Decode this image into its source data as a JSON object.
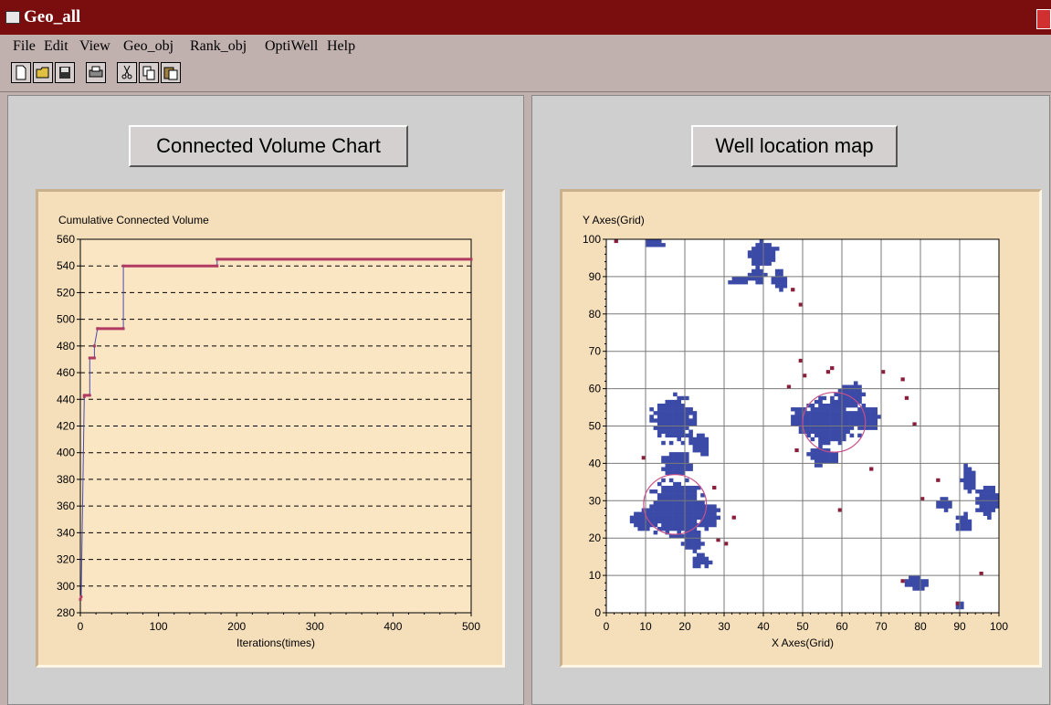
{
  "window": {
    "title": "Geo_all"
  },
  "menu": [
    "File",
    "Edit",
    "View",
    "Geo_obj",
    "Rank_obj",
    "OptiWell",
    "Help"
  ],
  "toolbar": [
    "new-icon",
    "open-icon",
    "save-icon",
    "print-icon",
    "cut-icon",
    "copy-icon",
    "paste-icon"
  ],
  "left_panel": {
    "button_label": "Connected Volume Chart"
  },
  "right_panel": {
    "button_label": "Well location map"
  },
  "chart_data": [
    {
      "type": "line",
      "title": "",
      "ylabel": "Cumulative Connected Volume",
      "xlabel": "Iterations(times)",
      "xlim": [
        0,
        500
      ],
      "ylim": [
        280,
        560
      ],
      "xticks": [
        0,
        100,
        200,
        300,
        400,
        500
      ],
      "yticks": [
        280,
        300,
        320,
        340,
        360,
        380,
        400,
        420,
        440,
        460,
        480,
        500,
        520,
        540,
        560
      ],
      "grid": "horizontal dashed",
      "series": [
        {
          "color": "#b03a62",
          "x": [
            0,
            1,
            5,
            5,
            12,
            12,
            18,
            18,
            22,
            22,
            55,
            55,
            175,
            175,
            500
          ],
          "y": [
            290,
            292,
            442,
            443,
            443,
            471,
            471,
            480,
            493,
            493,
            493,
            540,
            540,
            545,
            545
          ]
        }
      ]
    },
    {
      "type": "scatter",
      "title": "",
      "ylabel": "Y Axes(Grid)",
      "xlabel": "X Axes(Grid)",
      "xlim": [
        0,
        100
      ],
      "ylim": [
        0,
        100
      ],
      "xticks": [
        0,
        10,
        20,
        30,
        40,
        50,
        60,
        70,
        80,
        90,
        100
      ],
      "yticks": [
        0,
        10,
        20,
        30,
        40,
        50,
        60,
        70,
        80,
        90,
        100
      ],
      "grid": true,
      "colors": {
        "connected": "#3a4aa6",
        "isolated": "#8a1f3c",
        "well_circle": "#c8508c"
      },
      "connected_blobs": [
        {
          "cx": 18,
          "cy": 28,
          "rx": 8,
          "ry": 8
        },
        {
          "cx": 10,
          "cy": 25,
          "rx": 4,
          "ry": 3
        },
        {
          "cx": 22,
          "cy": 20,
          "rx": 3,
          "ry": 4
        },
        {
          "cx": 17,
          "cy": 52,
          "rx": 6,
          "ry": 7
        },
        {
          "cx": 18,
          "cy": 40,
          "rx": 4,
          "ry": 4
        },
        {
          "cx": 24,
          "cy": 45,
          "rx": 3,
          "ry": 3
        },
        {
          "cx": 26,
          "cy": 26,
          "rx": 3,
          "ry": 4
        },
        {
          "cx": 24,
          "cy": 14,
          "rx": 3,
          "ry": 2
        },
        {
          "cx": 57,
          "cy": 51,
          "rx": 8,
          "ry": 7
        },
        {
          "cx": 50,
          "cy": 52,
          "rx": 3,
          "ry": 4
        },
        {
          "cx": 62,
          "cy": 58,
          "rx": 4,
          "ry": 4
        },
        {
          "cx": 66,
          "cy": 52,
          "rx": 4,
          "ry": 4
        },
        {
          "cx": 55,
          "cy": 42,
          "rx": 4,
          "ry": 3
        },
        {
          "cx": 40,
          "cy": 96,
          "rx": 4,
          "ry": 4
        },
        {
          "cx": 38,
          "cy": 90,
          "rx": 3,
          "ry": 2
        },
        {
          "cx": 34,
          "cy": 89,
          "rx": 3,
          "ry": 1.5
        },
        {
          "cx": 44,
          "cy": 89,
          "rx": 2,
          "ry": 3
        },
        {
          "cx": 12,
          "cy": 99,
          "rx": 3,
          "ry": 1
        },
        {
          "cx": 97,
          "cy": 30,
          "rx": 3,
          "ry": 5
        },
        {
          "cx": 92,
          "cy": 36,
          "rx": 2,
          "ry": 4
        },
        {
          "cx": 91,
          "cy": 24,
          "rx": 2,
          "ry": 3
        },
        {
          "cx": 86,
          "cy": 29,
          "rx": 2,
          "ry": 2
        },
        {
          "cx": 79,
          "cy": 8,
          "rx": 3,
          "ry": 2
        },
        {
          "cx": 90,
          "cy": 2,
          "rx": 1.5,
          "ry": 1
        }
      ],
      "isolated_points": [
        [
          2,
          99
        ],
        [
          27,
          33
        ],
        [
          28,
          19
        ],
        [
          32,
          25
        ],
        [
          47,
          86
        ],
        [
          49,
          82
        ],
        [
          49,
          67
        ],
        [
          50,
          63
        ],
        [
          56,
          64
        ],
        [
          57,
          65
        ],
        [
          59,
          27
        ],
        [
          67,
          38
        ],
        [
          70,
          64
        ],
        [
          75,
          62
        ],
        [
          76,
          57
        ],
        [
          78,
          50
        ],
        [
          48,
          43
        ],
        [
          84,
          35
        ],
        [
          75,
          8
        ],
        [
          89,
          2
        ],
        [
          95,
          10
        ],
        [
          9,
          41
        ],
        [
          30,
          18
        ],
        [
          46,
          60
        ],
        [
          80,
          30
        ]
      ],
      "well_circles": [
        {
          "cx": 17.5,
          "cy": 29,
          "r": 8
        },
        {
          "cx": 58,
          "cy": 51,
          "r": 8
        }
      ]
    }
  ]
}
